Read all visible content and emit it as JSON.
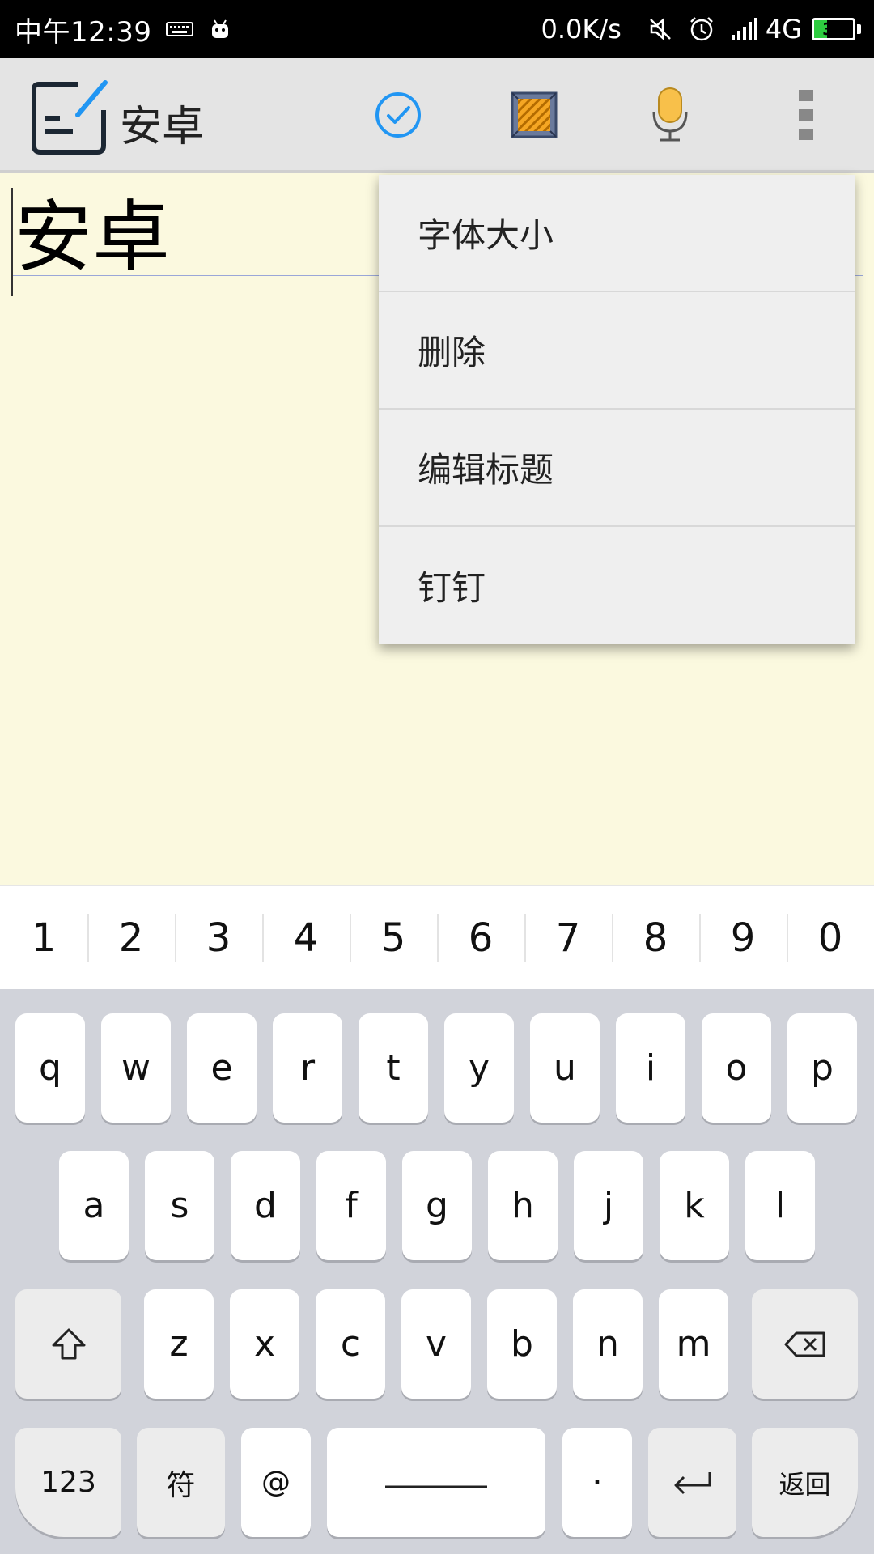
{
  "status_bar": {
    "time": "中午12:39",
    "net_speed": "0.0K/s",
    "network": "4G",
    "battery": "33",
    "battery_level": 0.33,
    "icons": [
      "keyboard-icon",
      "android-icon",
      "mute-icon",
      "alarm-icon",
      "signal-icon"
    ]
  },
  "action_bar": {
    "title": "安卓",
    "icons": [
      "app-logo-icon",
      "check-icon",
      "color-pattern-icon",
      "microphone-icon",
      "overflow-menu-icon"
    ],
    "accent_color": "#2196f3"
  },
  "editor": {
    "note_title": "安卓",
    "background": "#fbf9df"
  },
  "menu": {
    "items": [
      "字体大小",
      "删除",
      "编辑标题",
      "钉钉"
    ]
  },
  "keyboard": {
    "numbers": [
      "1",
      "2",
      "3",
      "4",
      "5",
      "6",
      "7",
      "8",
      "9",
      "0"
    ],
    "row1": [
      "q",
      "w",
      "e",
      "r",
      "t",
      "y",
      "u",
      "i",
      "o",
      "p"
    ],
    "row2": [
      "a",
      "s",
      "d",
      "f",
      "g",
      "h",
      "j",
      "k",
      "l"
    ],
    "row3": [
      "z",
      "x",
      "c",
      "v",
      "b",
      "n",
      "m"
    ],
    "bottom": {
      "num_label": "123",
      "symbol_label": "符",
      "at_label": "@",
      "period_label": "·",
      "return_label": "返回"
    }
  }
}
